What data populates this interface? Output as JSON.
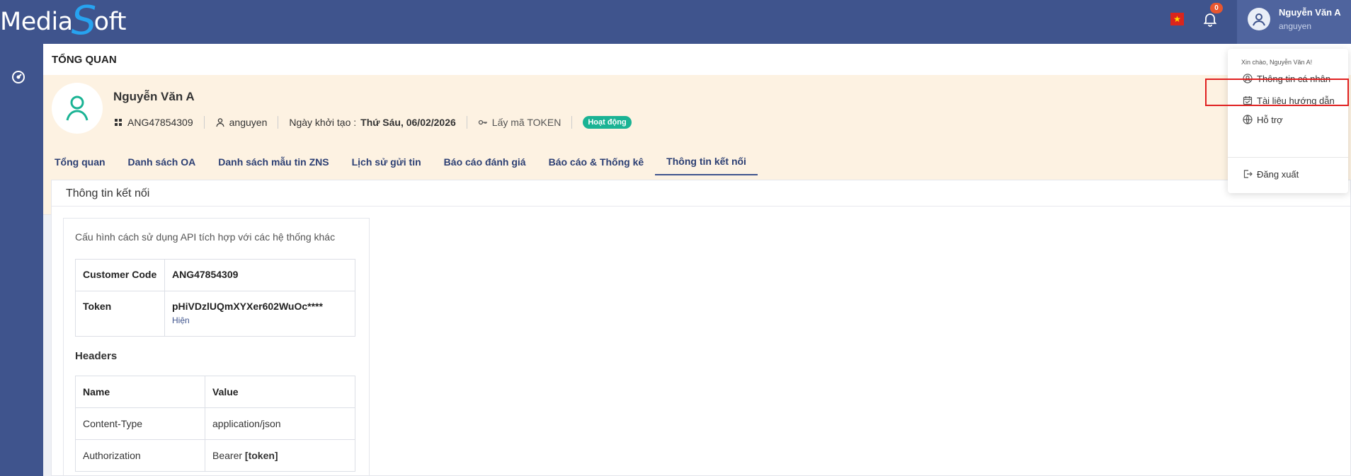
{
  "brand": {
    "logo_pre": "Media",
    "logo_s": "S",
    "logo_post": "oft"
  },
  "header": {
    "flag_symbol": "★",
    "notification_count": "0",
    "user_name": "Nguyễn Văn A",
    "user_login": "anguyen"
  },
  "page": {
    "title": "TỔNG QUAN"
  },
  "profile": {
    "name": "Nguyễn Văn A",
    "code": "ANG47854309",
    "username": "anguyen",
    "created_label": "Ngày khởi tạo :",
    "created_value": "Thứ Sáu, 06/02/2026",
    "token_link": "Lấy mã TOKEN",
    "status": "Hoạt động"
  },
  "tabs": [
    {
      "label": "Tổng quan"
    },
    {
      "label": "Danh sách OA"
    },
    {
      "label": "Danh sách mẫu tin ZNS"
    },
    {
      "label": "Lịch sử gửi tin"
    },
    {
      "label": "Báo cáo đánh giá"
    },
    {
      "label": "Báo cáo & Thống kê"
    },
    {
      "label": "Thông tin kết nối"
    }
  ],
  "connection": {
    "title": "Thông tin kết nối",
    "description": "Cấu hình cách sử dụng API tích hợp với các hệ thống khác",
    "customer_code_label": "Customer Code",
    "customer_code_value": "ANG47854309",
    "token_label": "Token",
    "token_value": "pHiVDzlUQmXYXer602WuOc****",
    "token_show": "Hiện",
    "headers_title": "Headers",
    "headers_table": {
      "columns": [
        "Name",
        "Value"
      ],
      "rows": [
        {
          "name": "Content-Type",
          "value": "application/json"
        },
        {
          "name": "Authorization",
          "value_prefix": "Bearer",
          "value_bold": "[token]"
        }
      ]
    }
  },
  "dropdown": {
    "greeting": "Xin chào, Nguyễn Văn A!",
    "items": [
      {
        "label": "Thông tin cá nhân",
        "icon": "user-circle-icon"
      },
      {
        "label": "Tài liệu hướng dẫn",
        "icon": "calendar-doc-icon"
      },
      {
        "label": "Hỗ trợ",
        "icon": "globe-icon"
      },
      {
        "label": "Đăng xuất",
        "icon": "logout-icon"
      }
    ]
  },
  "colors": {
    "nav": "#3f548d",
    "accent": "#27a3f0",
    "status": "#1ab394",
    "badge": "#e8562f",
    "highlight": "#e02020"
  }
}
